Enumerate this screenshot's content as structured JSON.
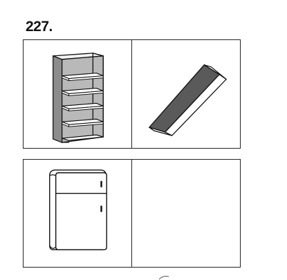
{
  "problem": {
    "number": "227."
  },
  "panels": [
    {
      "icon": "bookshelf-icon"
    },
    {
      "icon": "book-icon"
    },
    {
      "icon": "refrigerator-icon"
    },
    {
      "icon": "empty"
    }
  ]
}
